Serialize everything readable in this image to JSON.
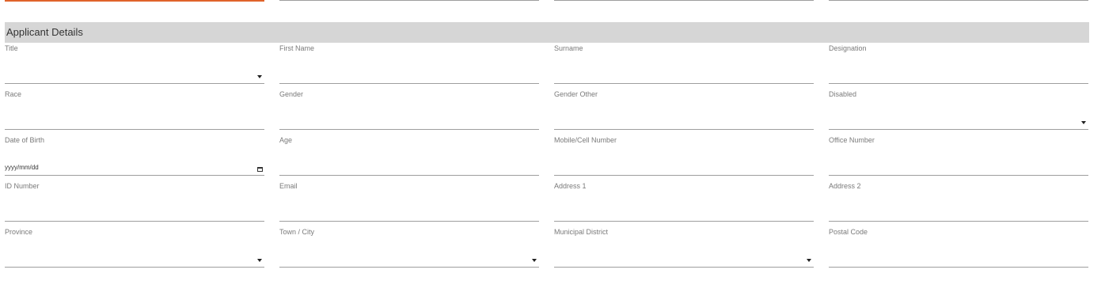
{
  "section": {
    "title": "Applicant Details"
  },
  "fields": {
    "title": {
      "label": "Title"
    },
    "first_name": {
      "label": "First Name"
    },
    "surname": {
      "label": "Surname"
    },
    "designation": {
      "label": "Designation"
    },
    "race": {
      "label": "Race"
    },
    "gender": {
      "label": "Gender"
    },
    "gender_other": {
      "label": "Gender Other"
    },
    "disabled": {
      "label": "Disabled"
    },
    "date_of_birth": {
      "label": "Date of Birth",
      "placeholder": "yyyy/mm/dd"
    },
    "age": {
      "label": "Age"
    },
    "mobile": {
      "label": "Mobile/Cell Number"
    },
    "office": {
      "label": "Office Number"
    },
    "id_number": {
      "label": "ID Number"
    },
    "email": {
      "label": "Email"
    },
    "address1": {
      "label": "Address 1"
    },
    "address2": {
      "label": "Address 2"
    },
    "province": {
      "label": "Province"
    },
    "town_city": {
      "label": "Town / City"
    },
    "municipal_district": {
      "label": "Municipal District"
    },
    "postal_code": {
      "label": "Postal Code"
    }
  },
  "colors": {
    "accent": "#e0632a",
    "header_bg": "#d6d6d6",
    "underline": "#9e9e9e"
  }
}
